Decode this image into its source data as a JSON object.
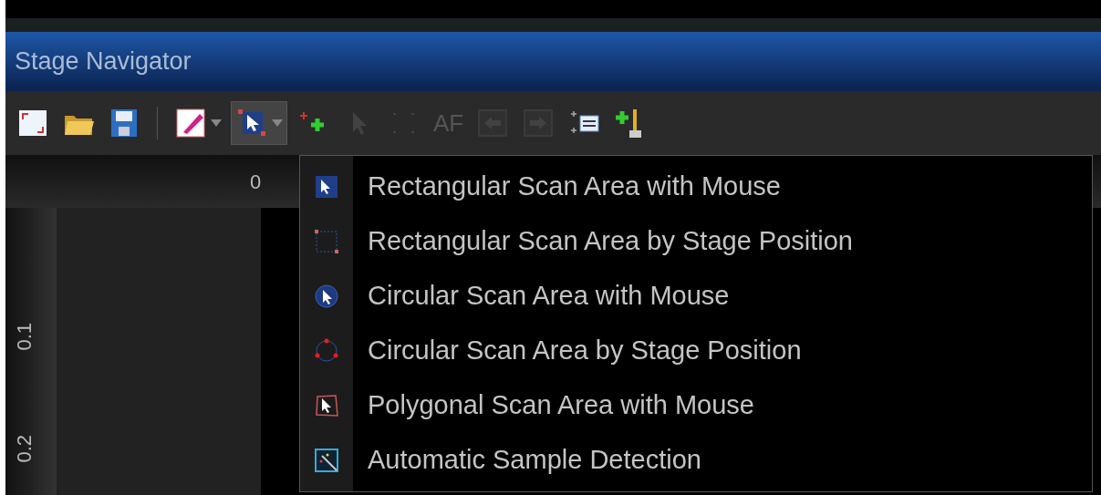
{
  "window": {
    "title": "Stage Navigator"
  },
  "toolbar": [
    {
      "kind": "button",
      "disabled": false,
      "pressed": false
    },
    {
      "kind": "button",
      "disabled": false,
      "pressed": false
    },
    {
      "kind": "button",
      "disabled": false,
      "pressed": false
    },
    {
      "kind": "separator"
    },
    {
      "kind": "split",
      "disabled": false,
      "pressed": false
    },
    {
      "kind": "split",
      "disabled": false,
      "pressed": true
    },
    {
      "kind": "button",
      "disabled": false,
      "pressed": false
    },
    {
      "kind": "button",
      "disabled": true,
      "pressed": false
    },
    {
      "kind": "button",
      "disabled": true,
      "pressed": false
    },
    {
      "kind": "text",
      "label": "AF",
      "disabled": true,
      "pressed": false
    },
    {
      "kind": "button",
      "disabled": true,
      "pressed": false
    },
    {
      "kind": "button",
      "disabled": true,
      "pressed": false
    },
    {
      "kind": "button",
      "disabled": false,
      "pressed": false
    },
    {
      "kind": "button",
      "disabled": false,
      "pressed": false
    }
  ],
  "rulers": {
    "top_labels": [
      "0"
    ],
    "left_labels": [
      "0.1",
      "0.2"
    ]
  },
  "menu": {
    "items": [
      {
        "label": "Rectangular Scan Area with Mouse"
      },
      {
        "label": "Rectangular Scan Area by Stage Position"
      },
      {
        "label": "Circular Scan Area with Mouse"
      },
      {
        "label": "Circular Scan Area by Stage Position"
      },
      {
        "label": "Polygonal Scan Area with Mouse"
      },
      {
        "label": "Automatic Sample Detection"
      }
    ]
  }
}
